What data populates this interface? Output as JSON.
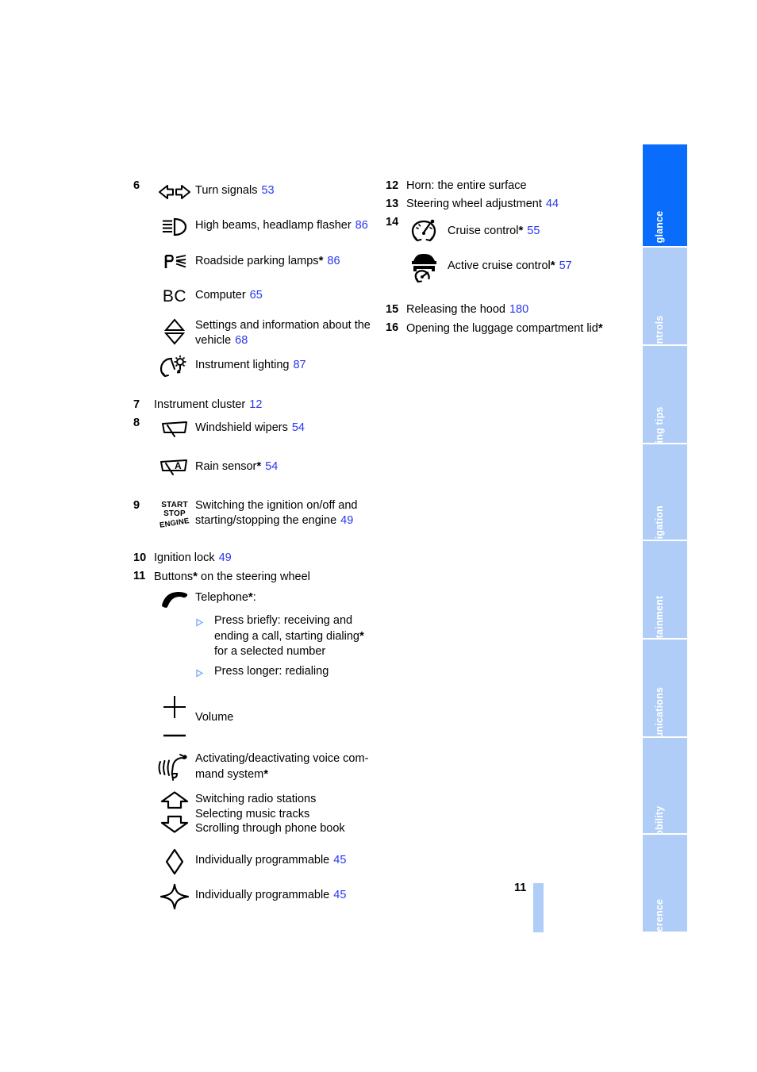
{
  "page": {
    "number": "11",
    "ref_color": "#2836F0",
    "tab_active_color": "#0A6CFA",
    "tab_inactive_color": "#AFCDF7"
  },
  "sidebar": {
    "tabs": [
      {
        "label": "At a glance",
        "active": true
      },
      {
        "label": "Controls",
        "active": false
      },
      {
        "label": "Driving tips",
        "active": false
      },
      {
        "label": "Navigation",
        "active": false
      },
      {
        "label": "Entertainment",
        "active": false
      },
      {
        "label": "Communications",
        "active": false
      },
      {
        "label": "Mobility",
        "active": false
      },
      {
        "label": "Reference",
        "active": false
      }
    ]
  },
  "left_column": {
    "item6": {
      "number": "6",
      "entries": [
        {
          "icon": "turn-signals-icon",
          "label": "Turn signals",
          "ref": "53"
        },
        {
          "icon": "high-beams-icon",
          "label": "High beams, headlamp flasher",
          "ref": "86"
        },
        {
          "icon": "roadside-parking-lamps-icon",
          "label": "Roadside parking lamps",
          "star": "*",
          "ref": "86"
        },
        {
          "icon": "bc-computer-icon",
          "icon_text": "BC",
          "label": "Computer",
          "ref": "65"
        },
        {
          "icon": "settings-updown-icon",
          "label": "Settings and information about the vehicle",
          "ref": "68"
        },
        {
          "icon": "instrument-lighting-icon",
          "label": "Instrument lighting",
          "ref": "87"
        }
      ]
    },
    "item7": {
      "number": "7",
      "label": "Instrument cluster",
      "ref": "12"
    },
    "item8": {
      "number": "8",
      "entries": [
        {
          "icon": "windshield-wipers-icon",
          "label": "Windshield wipers",
          "ref": "54"
        },
        {
          "icon": "rain-sensor-icon",
          "icon_text": "A",
          "label": "Rain sensor",
          "star": "*",
          "ref": "54"
        }
      ]
    },
    "item9": {
      "number": "9",
      "icon": "start-stop-engine-icon",
      "icon_lines": [
        "START",
        "STOP",
        "ENGINE"
      ],
      "label_line1": "Switching the ignition on/off and",
      "label_line2": "starting/stopping the engine",
      "ref": "49"
    },
    "item10": {
      "number": "10",
      "label": "Ignition lock",
      "ref": "49"
    },
    "item11": {
      "number": "11",
      "label": "Buttons",
      "star": "*",
      "label_rest": " on the steering wheel",
      "telephone": {
        "icon": "telephone-handset-icon",
        "label": "Telephone",
        "star": "*",
        "colon": ":",
        "bullets": [
          "Press briefly: receiving and ending a call, starting dialing* for a selected number",
          "Press longer: redialing"
        ],
        "bullet1_lines": [
          "Press briefly: receiving and",
          "ending a call, starting dialing",
          "for a selected number"
        ],
        "bullet1_star": "*",
        "bullet2": "Press longer: redialing"
      },
      "volume": {
        "icon": "volume-plus-minus-icon",
        "label": "Volume"
      },
      "voice": {
        "icon": "voice-command-icon",
        "label_line1": "Activating/deactivating voice com-",
        "label_line2": "mand system",
        "star": "*"
      },
      "arrows": {
        "icon_up": "arrow-up-icon",
        "icon_down": "arrow-down-icon",
        "lines": [
          "Switching radio stations",
          "Selecting music tracks",
          "Scrolling through phone book"
        ]
      },
      "programmable1": {
        "icon": "diamond-icon",
        "label": "Individually programmable",
        "ref": "45"
      },
      "programmable2": {
        "icon": "four-point-star-icon",
        "label": "Individually programmable",
        "ref": "45"
      }
    }
  },
  "right_column": {
    "item12": {
      "number": "12",
      "label": "Horn: the entire surface"
    },
    "item13": {
      "number": "13",
      "label": "Steering wheel adjustment",
      "ref": "44"
    },
    "item14": {
      "number": "14",
      "entries": [
        {
          "icon": "cruise-control-icon",
          "label": "Cruise control",
          "star": "*",
          "ref": "55"
        },
        {
          "icon": "active-cruise-control-icon",
          "label": "Active cruise control",
          "star": "*",
          "ref": "57"
        }
      ]
    },
    "item15": {
      "number": "15",
      "label": "Releasing the hood",
      "ref": "180"
    },
    "item16": {
      "number": "16",
      "label": "Opening the luggage compartment lid",
      "star": "*"
    }
  }
}
